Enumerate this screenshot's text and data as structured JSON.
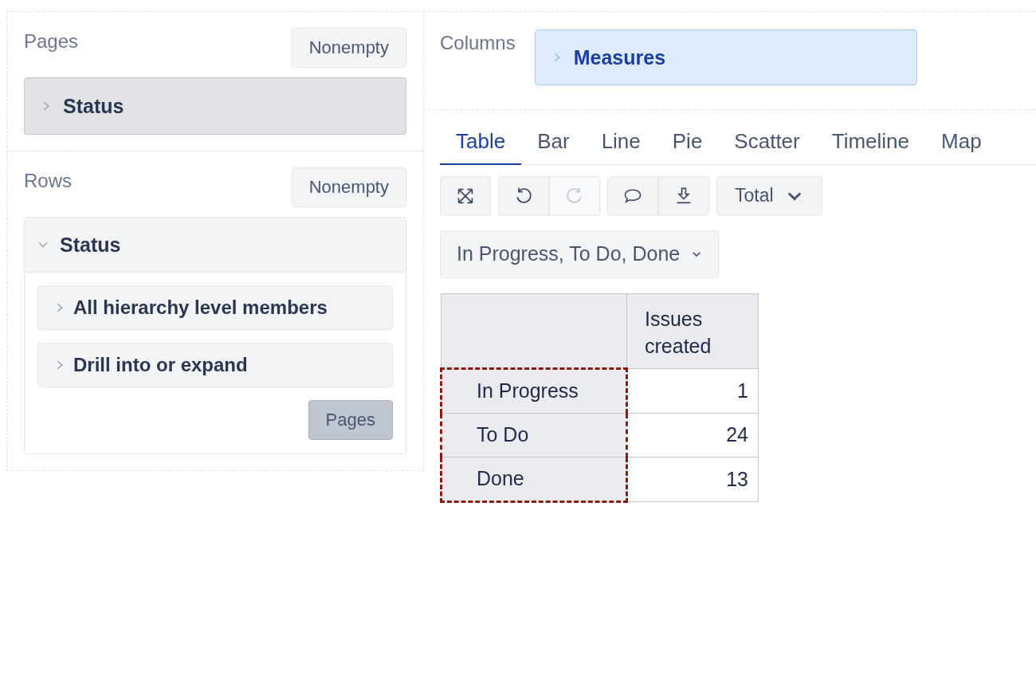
{
  "pages": {
    "title": "Pages",
    "nonempty_button": "Nonempty",
    "items": [
      {
        "label": "Status",
        "expanded": false
      }
    ]
  },
  "rows": {
    "title": "Rows",
    "nonempty_button": "Nonempty",
    "items": [
      {
        "label": "Status",
        "expanded": true,
        "options": [
          {
            "label": "All hierarchy level members"
          },
          {
            "label": "Drill into or expand"
          }
        ],
        "move_button": "Pages"
      }
    ]
  },
  "columns": {
    "title": "Columns",
    "items": [
      {
        "label": "Measures",
        "expanded": false
      }
    ]
  },
  "tabs": [
    {
      "label": "Table",
      "selected": true
    },
    {
      "label": "Bar",
      "selected": false
    },
    {
      "label": "Line",
      "selected": false
    },
    {
      "label": "Pie",
      "selected": false
    },
    {
      "label": "Scatter",
      "selected": false
    },
    {
      "label": "Timeline",
      "selected": false
    },
    {
      "label": "Map",
      "selected": false
    }
  ],
  "toolbar": {
    "groups": [
      [
        {
          "kind": "fullscreen",
          "disabled": false
        }
      ],
      [
        {
          "kind": "undo",
          "disabled": false
        },
        {
          "kind": "redo",
          "disabled": true
        }
      ],
      [
        {
          "kind": "comment",
          "disabled": false
        },
        {
          "kind": "export",
          "disabled": false
        }
      ]
    ],
    "total_dropdown": "Total"
  },
  "filter_dropdown": "In Progress, To Do, Done",
  "table": {
    "columns": [
      "Issues created"
    ],
    "rows": [
      {
        "header": "In Progress",
        "values": [
          "1"
        ],
        "highlighted": true
      },
      {
        "header": "To Do",
        "values": [
          "24"
        ],
        "highlighted": true
      },
      {
        "header": "Done",
        "values": [
          "13"
        ],
        "highlighted": true
      }
    ]
  }
}
